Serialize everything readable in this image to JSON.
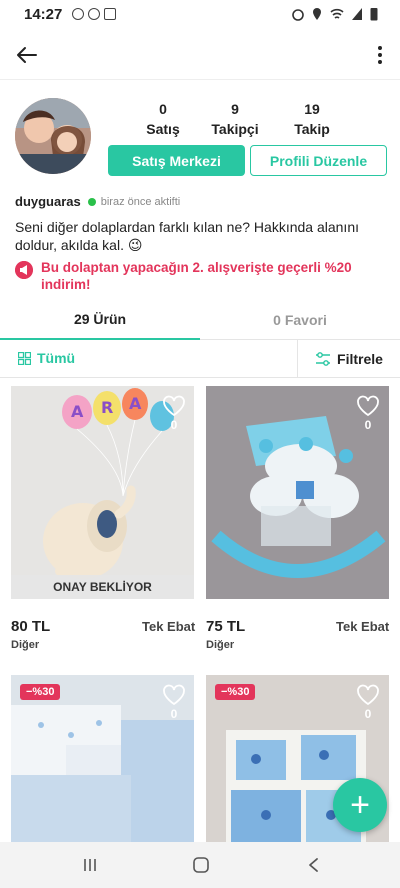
{
  "status_bar": {
    "time": "14:27"
  },
  "profile": {
    "stats": [
      {
        "count": "0",
        "label": "Satış"
      },
      {
        "count": "9",
        "label": "Takipçi"
      },
      {
        "count": "19",
        "label": "Takip"
      }
    ],
    "primary_button": "Satış Merkezi",
    "secondary_button": "Profili Düzenle",
    "username": "duyguaras",
    "activity": "biraz önce aktifti",
    "about": "Seni diğer dolaplardan farklı kılan ne? Hakkında alanını doldur, akılda kal. 😉",
    "promo": "Bu dolaptan yapacağın 2. alışverişte geçerli %20 indirim!"
  },
  "tabs": [
    {
      "label": "29 Ürün",
      "active": true
    },
    {
      "label": "0 Favori",
      "active": false
    }
  ],
  "filters": {
    "all_label": "Tümü",
    "filter_label": "Filtrele"
  },
  "products": [
    {
      "like_count": "0",
      "status": "ONAY BEKLİYOR",
      "price": "80 TL",
      "size": "Tek Ebat",
      "brand": "Diğer"
    },
    {
      "like_count": "0",
      "price": "75 TL",
      "size": "Tek Ebat",
      "brand": "Diğer"
    },
    {
      "like_count": "0",
      "discount": "−%30"
    },
    {
      "like_count": "0",
      "discount": "−%30"
    }
  ],
  "fab_label": "+",
  "icons": {
    "back": "arrow-left-icon",
    "more": "more-vertical-icon",
    "heart": "heart-icon",
    "grid": "grid-icon",
    "filter": "sliders-icon",
    "megaphone": "megaphone-icon"
  },
  "colors": {
    "accent": "#29c7a2",
    "promo": "#e3355b",
    "online": "#2ac04a"
  }
}
